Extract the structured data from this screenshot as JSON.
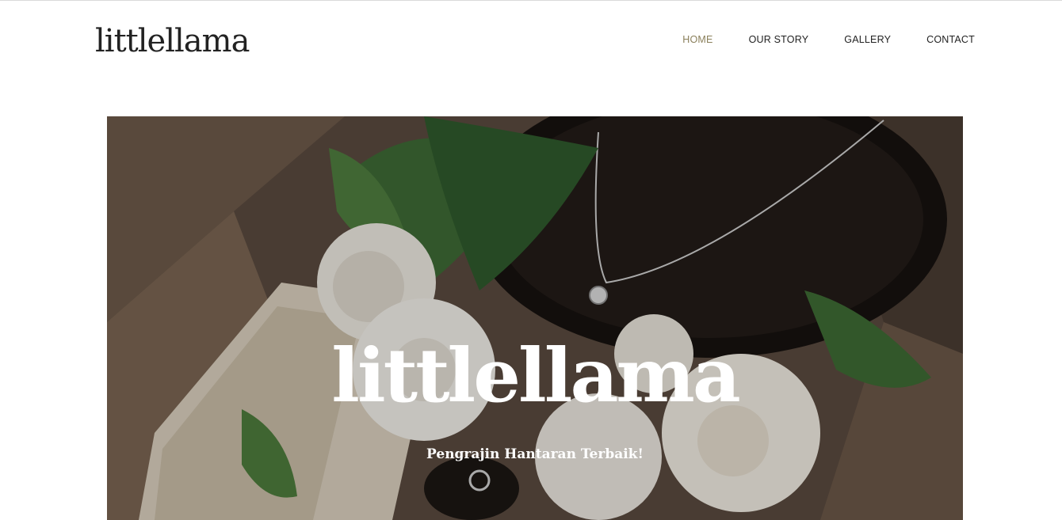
{
  "header": {
    "logo": "littlellama",
    "nav": [
      {
        "label": "HOME",
        "active": true
      },
      {
        "label": "OUR STORY",
        "active": false
      },
      {
        "label": "GALLERY",
        "active": false
      },
      {
        "label": "CONTACT",
        "active": false
      }
    ]
  },
  "hero": {
    "title": "littlellama",
    "subtitle": "Pengrajin Hantaran Terbaik!"
  },
  "colors": {
    "nav_active": "#8a7f5a",
    "text": "#222222",
    "hero_text": "#ffffff"
  }
}
